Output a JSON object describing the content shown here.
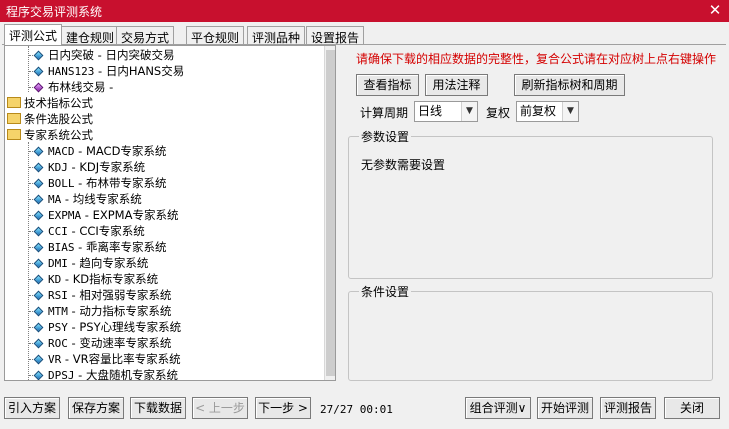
{
  "window": {
    "title": "程序交易评测系统",
    "close_glyph": "✕"
  },
  "tabs": [
    "评测公式",
    "建仓规则",
    "交易方式",
    "平仓规则",
    "评测品种",
    "设置报告"
  ],
  "tree": {
    "rows": [
      {
        "kind": "item",
        "icon": "diamond-blue",
        "code": "",
        "label": "日内突破 - 日内突破交易"
      },
      {
        "kind": "item",
        "icon": "diamond-blue",
        "code": "HANS123",
        "label": " - 日内HANS交易"
      },
      {
        "kind": "item",
        "icon": "diamond-purple",
        "code": "",
        "label": "布林线交易 -"
      },
      {
        "kind": "folder",
        "label": "技术指标公式"
      },
      {
        "kind": "folder",
        "label": "条件选股公式"
      },
      {
        "kind": "folder",
        "label": "专家系统公式"
      },
      {
        "kind": "item",
        "icon": "diamond-blue",
        "code": "MACD",
        "label": " - MACD专家系统"
      },
      {
        "kind": "item",
        "icon": "diamond-blue",
        "code": "KDJ",
        "label": " - KDJ专家系统"
      },
      {
        "kind": "item",
        "icon": "diamond-blue",
        "code": "BOLL",
        "label": " - 布林带专家系统"
      },
      {
        "kind": "item",
        "icon": "diamond-blue",
        "code": "MA",
        "label": " - 均线专家系统"
      },
      {
        "kind": "item",
        "icon": "diamond-blue",
        "code": "EXPMA",
        "label": " - EXPMA专家系统"
      },
      {
        "kind": "item",
        "icon": "diamond-blue",
        "code": "CCI",
        "label": " - CCI专家系统"
      },
      {
        "kind": "item",
        "icon": "diamond-blue",
        "code": "BIAS",
        "label": " - 乖离率专家系统"
      },
      {
        "kind": "item",
        "icon": "diamond-blue",
        "code": "DMI",
        "label": " - 趋向专家系统"
      },
      {
        "kind": "item",
        "icon": "diamond-blue",
        "code": "KD",
        "label": " - KD指标专家系统"
      },
      {
        "kind": "item",
        "icon": "diamond-blue",
        "code": "RSI",
        "label": " - 相对强弱专家系统"
      },
      {
        "kind": "item",
        "icon": "diamond-blue",
        "code": "MTM",
        "label": " - 动力指标专家系统"
      },
      {
        "kind": "item",
        "icon": "diamond-blue",
        "code": "PSY",
        "label": " - PSY心理线专家系统"
      },
      {
        "kind": "item",
        "icon": "diamond-blue",
        "code": "ROC",
        "label": " - 变动速率专家系统"
      },
      {
        "kind": "item",
        "icon": "diamond-blue",
        "code": "VR",
        "label": " - VR容量比率专家系统"
      },
      {
        "kind": "item",
        "icon": "diamond-blue",
        "code": "DPSJ",
        "label": " - 大盘随机专家系统"
      }
    ]
  },
  "right": {
    "notice": "请确保下载的相应数据的完整性，复合公式请在对应树上点右键操作",
    "buttons": {
      "view_indicator": "查看指标",
      "usage_note": "用法注释",
      "refresh": "刷新指标树和周期"
    },
    "period_label": "计算周期",
    "period_value": "日线",
    "adjust_label": "复权",
    "adjust_value": "前复权",
    "params_group": {
      "title": "参数设置",
      "content": "无参数需要设置"
    },
    "conditions_group": {
      "title": "条件设置"
    }
  },
  "bottom": {
    "import": "引入方案",
    "save": "保存方案",
    "download": "下载数据",
    "prev": "< 上一步",
    "next": "下一步 >",
    "status": "27/27 00:01",
    "combo": "组合评测∨",
    "start": "开始评测",
    "report": "评测报告",
    "close": "关闭"
  },
  "colors": {
    "titlebar": "#c8102e",
    "notice": "#d40000"
  }
}
